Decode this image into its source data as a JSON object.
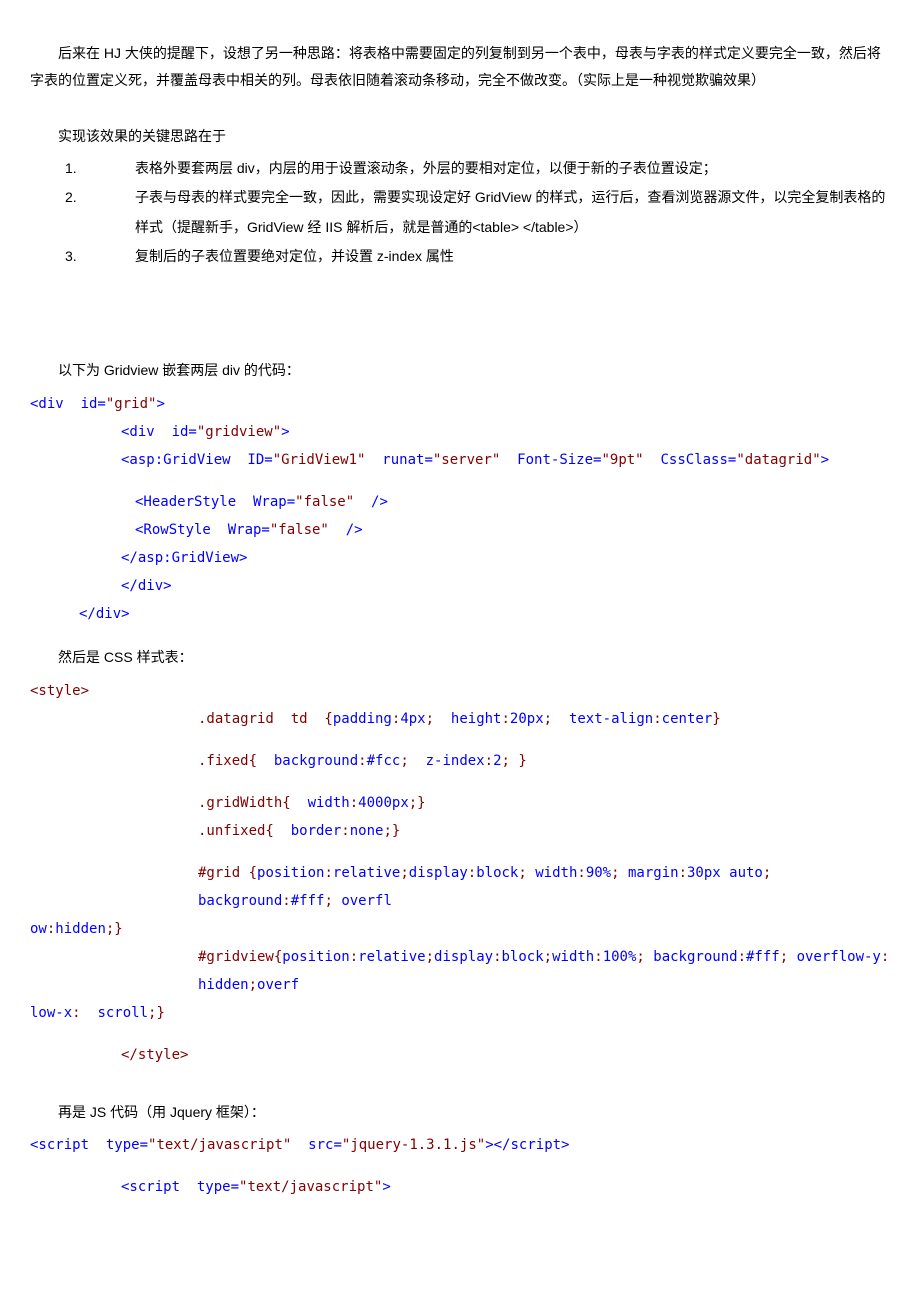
{
  "intro": "后来在 HJ 大侠的提醒下，设想了另一种思路：将表格中需要固定的列复制到另一个表中，母表与字表的样式定义要完全一致，然后将字表的位置定义死，并覆盖母表中相关的列。母表依旧随着滚动条移动，完全不做改变。（实际上是一种视觉欺骗效果）",
  "key_hdr": "实现该效果的关键思路在于",
  "list": {
    "n1": "1.",
    "t1": "表格外要套两层 div，内层的用于设置滚动条，外层的要相对定位，以便于新的子表位置设定；",
    "n2": "2.",
    "t2": "子表与母表的样式要完全一致，因此，需要实现设定好 GridView 的样式，运行后，查看浏览器源文件，以完全复制表格的样式（提醒新手，GridView 经 IIS 解析后，就是普通的<table> </table>）",
    "n3": "3.",
    "t3": "复制后的子表位置要绝对定位，并设置 z-index 属性"
  },
  "sec1_hdr": "以下为 Gridview 嵌套两层 div 的代码：",
  "c": {
    "d1a": "<div  id=",
    "d1b": "\"grid\"",
    "d1c": ">",
    "d2a": "<div  id=",
    "d2b": "\"gridview\"",
    "d2c": ">",
    "g1a": "<asp:GridView  ID=",
    "g1b": "\"GridView1\"",
    "g1c": "  runat=",
    "g1d": "\"server\"",
    "g1e": "  Font-Size=",
    "g1f": "\"9pt\"",
    "g1g": "  CssClass=",
    "g1h": "\"datagrid\"",
    "g1i": ">",
    "h1a": "<HeaderStyle  Wrap=",
    "h1b": "\"false\"",
    "h1c": "  />",
    "r1a": "<RowStyle  Wrap=",
    "r1b": "\"false\"",
    "r1c": "  />",
    "ge": "</asp:GridView>",
    "de2": "</div>",
    "de1": "</div>"
  },
  "sec2_hdr": "然后是 CSS 样式表：",
  "css": {
    "open": "<style>",
    "l1a": ".datagrid  td  {",
    "l1b": "padding",
    "l1c": ":",
    "l1d": "4px",
    "l1e": ";  ",
    "l1f": "height",
    "l1g": ":",
    "l1h": "20px",
    "l1i": ";  ",
    "l1j": "text-align",
    "l1k": ":",
    "l1l": "center",
    "l1m": "}",
    "l2a": ".fixed{  ",
    "l2b": "background",
    "l2c": ":",
    "l2d": "#fcc",
    "l2e": ";  ",
    "l2f": "z-index",
    "l2g": ":",
    "l2h": "2",
    "l2i": "; }",
    "l3a": ".gridWidth{  ",
    "l3b": "width",
    "l3c": ":",
    "l3d": "4000px",
    "l3e": ";}",
    "l4a": ".unfixed{  ",
    "l4b": "border",
    "l4c": ":",
    "l4d": "none",
    "l4e": ";}",
    "l5a": "#grid  {",
    "l5b": "position",
    "l5c": ":",
    "l5d": "relative",
    "l5e": ";",
    "l5f": "display",
    "l5g": ":",
    "l5h": "block",
    "l5i": ";  ",
    "l5j": "width",
    "l5k": ":",
    "l5l": "90%",
    "l5m": ";  ",
    "l5n": "margin",
    "l5o": ":",
    "l5p": "30px  auto",
    "l5q": ";  ",
    "l5r": "background",
    "l5s": ":",
    "l5t": "#fff",
    "l5u": ";  ",
    "l5v": "overfl",
    "l5w": "ow",
    "l5x": ":",
    "l5y": "hidden",
    "l5z": ";}",
    "l6a": "#gridview{",
    "l6b": "position",
    "l6c": ":",
    "l6d": "relative",
    "l6e": ";",
    "l6f": "display",
    "l6g": ":",
    "l6h": "block",
    "l6i": ";",
    "l6j": "width",
    "l6k": ":",
    "l6l": "100%",
    "l6m": ";  ",
    "l6n": "background",
    "l6o": ":",
    "l6p": "#fff",
    "l6q": ";  ",
    "l6r": "overflow-y",
    "l6s": ":  ",
    "l6t": "hidden",
    "l6u": ";",
    "l6v": "overf",
    "l6w": "low-x",
    "l6x": ":  ",
    "l6y": "scroll",
    "l6z": ";}",
    "close": "</style>"
  },
  "sec3_hdr": "再是 JS 代码（用 Jquery 框架）：",
  "js": {
    "s1a": "<script  type=",
    "s1b": "\"text/javascript\"",
    "s1c": "  src=",
    "s1d": "\"jquery-1.3.1.js\"",
    "s1e": "></script>",
    "s2a": "<script  type=",
    "s2b": "\"text/javascript\"",
    "s2c": ">"
  }
}
